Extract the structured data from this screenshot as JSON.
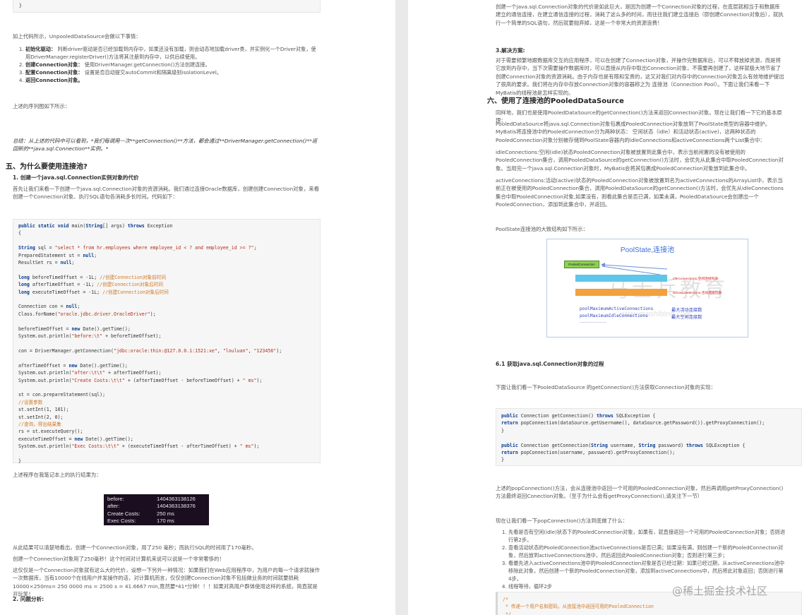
{
  "left": {
    "intro": "如上代码所示，UnpooledDataSource会做以下事情：",
    "steps": [
      {
        "bold": "初始化驱动：",
        "text": "判断driver驱动是否已经加载到内存中，如果还没有加载，则会动态地加载driver类，并实例化一个Driver对象，使用DriverManager.registerDriver()方法将其注册到内存中，以供后续使用。"
      },
      {
        "bold": "创建Connection对象：",
        "text": "使用DriverManager.getConnection()方法创建连接。"
      },
      {
        "bold": "配置Connection对象：",
        "text": "设置是否自动提交autoCommit和隔离级别isolationLevel。"
      },
      {
        "bold": "返回Connection对象。",
        "text": ""
      }
    ],
    "seq_note": "上述的序列图如下所示：",
    "summary": "总结：从上述的代码中可以看到，*我们每调用一次**getConnection()**方法，都会通过**DriverManager.getConnection()**返回新的**java.sql.Connection**实例。*",
    "section5_title": "五、为什么要使用连接池?",
    "sub1": "1. 创建一个java.sql.Connection实例对象的代价",
    "sub1_text": "首先让我们来看一下创建一个java.sql.Connection对象的资源消耗。我们通过连接Oracle数据库，创建创建Connection对象，来看创建一个Connection对象、执行SQL语句各消耗多长时间。代码如下：",
    "code_lines": [
      "public static void main(String[] args) throws Exception",
      "{",
      "",
      "String sql = \"select * from hr.employees where employee_id < ? and employee_id >= ?\";",
      "PreparedStatement st = null;",
      "ResultSet rs = null;",
      "",
      "long beforeTimeOffset = -1L; //创建Connection对象前时间",
      "long afterTimeOffset = -1L; //创建Connection对象后时间",
      "long executeTimeOffset = -1L; //创建Connection对象后时间",
      "",
      "Connection con = null;",
      "Class.forName(\"oracle.jdbc.driver.OracleDriver\");",
      "",
      "beforeTimeOffset = new Date().getTime();",
      "System.out.println(\"before:\\t\" + beforeTimeOffset);",
      "",
      "con = DriverManager.getConnection(\"jdbc:oracle:thin:@127.0.0.1:1521:xe\", \"louluan\", \"123456\");",
      "",
      "afterTimeOffset = new Date().getTime();",
      "System.out.println(\"after:\\t\\t\" + afterTimeOffset);",
      "System.out.println(\"Create Costs:\\t\\t\" + (afterTimeOffset - beforeTimeOffset) + \" ms\");",
      "",
      "st = con.prepareStatement(sql);",
      "//设置参数",
      "st.setInt(1, 101);",
      "st.setInt(2, 0);",
      "//查询，得出结果集",
      "rs = st.executeQuery();",
      "executeTimeOffset = new Date().getTime();",
      "System.out.println(\"Exec Costs:\\t\\t\" + (executeTimeOffset - afterTimeOffset) + \" ms\");",
      "",
      "}"
    ],
    "result_note": "上述程序在我笔记本上的执行结果为：",
    "terminal": [
      {
        "k": "before:",
        "v": "1404363138126"
      },
      {
        "k": "after:",
        "v": "1404363138376"
      },
      {
        "k": "Create Costs:",
        "v": "250 ms"
      },
      {
        "k": "Exec Costs:",
        "v": "170 ms"
      }
    ],
    "p_after1": "从此结果可以清楚地看出，创建一个Connection对象，用了250 毫秒；而执行SQL的时间用了170毫秒。",
    "p_after2": "创建一个Connection对象用了250毫秒！这个时间对计算机来说可以说是一个非常奢侈的！",
    "p_after3": "这仅仅是一个Connection对象就有这么大的代价，设想一下另外一种情况：如果我们在Web应用程序中，为用户的每一个请求就操作一次数据库，当有10000个在线用户并发操作的话，对计算机而言，仅仅创建Connection对象不包括做业务的时间就要损耗10000×250ms= 250 0000 ms = 2500 s = 41.6667 min,竟然要*41*分钟！！！如果对高用户群体使用这样的系统，简直就是开玩笑！",
    "sub2": "2. 问题分析:"
  },
  "right": {
    "top_para": "创建一个java.sql.Connection对象的代价是如此巨大，是因为创建一个Connection对象的过程，在底层就相当于和数据库建立的通信连接，在建立通信连接的过程，消耗了这么多的时间，而往往我们建立连接后（即创建Connection对象后），就执行一个简单的SQL语句，然后就要抛弃掉，这是一个非常大的资源浪费！",
    "sub3": "3.解决方案:",
    "sub3_text": "对于需要频繁地跟数据库交互的应用程序，可以在创建了Connection对象，并操作完数据库后，可以不释放掉资源，而是将它放到内存中，当下次需要操作数据库时，可以直接从内存中取出Connection对象，不需要再创建了，这样就极大地节省了创建Connection对象的资源消耗。由于内存也是有限和宝贵的，这又对我们对内存中的Connection对象怎么有效地维护提出了很高的要求。我们将在内存中存放Connection对象的容器称之为 连接池（Connection Pool）。下面让我们来看一下MyBatis的线程池是怎样实现的。",
    "section6_title": "六、使用了连接池的PooledDataSource",
    "s6_p1": "同样地，我们也是使用PooledDataSource的getConnection()方法来返回Connection对象。现在让我们看一下它的基本原理：",
    "s6_p2": "PooledDataSource将java.sql.Connection对象包裹成PooledConnection对象放到了PoolState类型的容器中维护。 MyBatis将连接池中的PooledConnection分为两种状态： 空闲状态（idle）和活动状态(active)，这两种状态的PooledConnection对象分别被存储到PoolState容器内的idleConnections和activeConnections两个List集合中：",
    "s6_idle": "idleConnections:空闲(idle)状态PooledConnection对象被放置到此集合中，表示当前闲置的没有被使用的PooledConnection集合，调用PooledDataSource的getConnection()方法时，会优先从此集合中取PooledConnection对象。当用完一个java.sql.Connection对象时，MyBatis会将其包裹成PooledConnection对象放到此集合中。",
    "s6_active": "activeConnections:活动(active)状态的PooledConnection对象被放置到名为activeConnections的ArrayList中，表示当前正在被使用的PooledConnection集合，调用PooledDataSource的getConnection()方法时，会优先从idleConnections集合中取PooledConnection对象,如果没有，则看此集合是否已满，如果未满，PooledDataSource会创建出一个PooledConnection，添加到此集合中，并返回。",
    "struct_note": "PoolState连接池的大致结构如下所示：",
    "diagram": {
      "title": "PoolState,连接池",
      "pc_label": "PooledConnection",
      "idle_label": "idleConnections,空闲连接列表",
      "active_label": "activeConnections,活动连接列表",
      "max_active": "poolMaximumActiveConnections",
      "max_active_cn": "最大活动连接数",
      "max_idle": "poolMaximumIdleConnections",
      "max_idle_cn": "最大空闲连接数",
      "dots": "......................",
      "watermark1": "马士兵教育",
      "watermark2": "www.mashibing.com"
    },
    "sub61": "6.1 获取java.sql.Connection对象的过程",
    "sub61_text": "下面让我们看一下PooledDataSource 的getConnection()方法获取Connection对象的实现：",
    "code2_lines": [
      "public Connection getConnection() throws SQLException {",
      "return popConnection(dataSource.getUsername(), dataSource.getPassword()).getProxyConnection();",
      "}",
      "",
      "public Connection getConnection(String username, String password) throws SQLException {",
      "return popConnection(username, password).getProxyConnection();",
      "}"
    ],
    "after_code": "上述的popConnection()方法，会从连接池中返回一个可用的PooledConnection对象，然后再调用getProxyConnection()方法最终返回Conection对象。（至于为什么会有getProxyConnection(),请关注下一节）",
    "now_see": "现在让我们看一下popConnection()方法到底做了什么：",
    "steps": [
      "先看是否有空闲(idle)状态下的PooledConnection对象，如果有，就直接返回一个可用的PooledConnection对象；否则进行第2步。",
      "查看活动状态的PooledConnection池activeConnections是否已满；如果没有满，则创建一个新的PooledConnection对象，然后放到activeConnections池中，然后返回此PooledConnection对象；否则进行第三步；",
      "看最先进入activeConnections池中的PooledConnection对象是否已经过期：如果已经过期，从activeConnections池中移除此对象，然后创建一个新的PooledConnection对象，添加到activeConnections中，然后将此对象返回；否则进行第4步。",
      "线程等待，循环2步"
    ],
    "code3_lines": [
      "/*",
      " * 传递一个用户名和密码，从连接池中返回可用的PooledConnection",
      " */"
    ],
    "footer_watermark": "@稀土掘金技术社区"
  }
}
